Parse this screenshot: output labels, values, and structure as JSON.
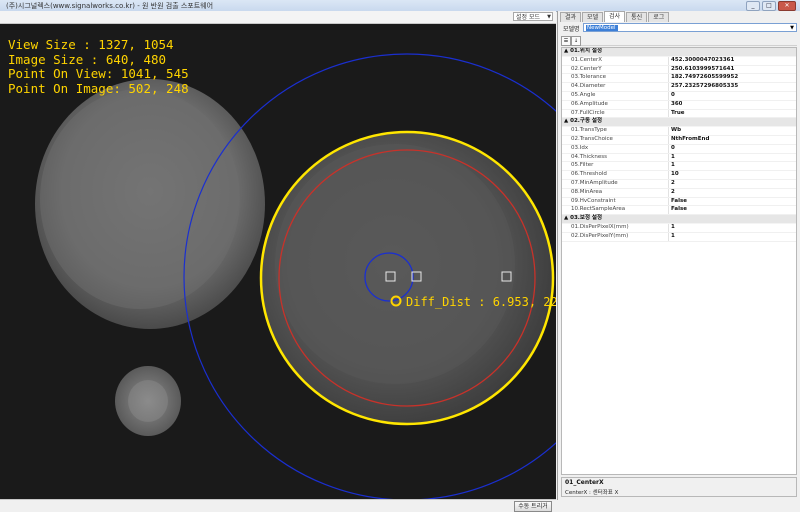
{
  "window": {
    "title": "(주)시그널렉스(www.signalworks.co.kr) - 원 반원 검출 스포트웨어",
    "minimize": "_",
    "maximize": "□",
    "close": "✕"
  },
  "toolbar": {
    "mode_label": "설정 모드"
  },
  "overlay": {
    "view_size": "View Size : 1327, 1054",
    "image_size": "Image Size : 640, 480",
    "point_on_view": "Point On View: 1041, 545",
    "point_on_image": "Point On Image: 502, 248",
    "diff_dist": "Diff_Dist : 6.953, 22."
  },
  "bottom": {
    "manual_trigger": "수동 트리거"
  },
  "panel": {
    "tabs": [
      {
        "label": "결과"
      },
      {
        "label": "모델"
      },
      {
        "label": "검사"
      },
      {
        "label": "통신"
      },
      {
        "label": "로그"
      }
    ],
    "model_label": "모델명",
    "model_value": "NewModel",
    "categories": [
      {
        "title": "01.위치 설정",
        "props": [
          {
            "name": "01.CenterX",
            "value": "452.3000047023361"
          },
          {
            "name": "02.CenterY",
            "value": "250.6103999571641"
          },
          {
            "name": "03.Tolerance",
            "value": "182.74972605599952"
          },
          {
            "name": "04.Diameter",
            "value": "257.23257296805335"
          },
          {
            "name": "05.Angle",
            "value": "0"
          },
          {
            "name": "06.Amplitude",
            "value": "360"
          },
          {
            "name": "07.FullCircle",
            "value": "True"
          }
        ]
      },
      {
        "title": "02.구동 설정",
        "props": [
          {
            "name": "01.TransType",
            "value": "Wb"
          },
          {
            "name": "02.TransChoice",
            "value": "NthFromEnd"
          },
          {
            "name": "03.Idx",
            "value": "0"
          },
          {
            "name": "04.Thickness",
            "value": "1"
          },
          {
            "name": "05.Filter",
            "value": "1"
          },
          {
            "name": "06.Threshold",
            "value": "10"
          },
          {
            "name": "07.MinAmplitude",
            "value": "2"
          },
          {
            "name": "08.MinArea",
            "value": "2"
          },
          {
            "name": "09.HvConstraint",
            "value": "False"
          },
          {
            "name": "10.RectSampleArea",
            "value": "False"
          }
        ]
      },
      {
        "title": "03.보정 설정",
        "props": [
          {
            "name": "01.DisPerPixelX(mm)",
            "value": "1"
          },
          {
            "name": "02.DisPerPixelY(mm)",
            "value": "1"
          }
        ]
      }
    ],
    "description": {
      "title": "01_CenterX",
      "text": "CenterX : 센터좌표 X"
    }
  },
  "colors": {
    "overlay_text": "#ffd400",
    "blue_circle": "#1a2fd0",
    "red_circle": "#c8322a",
    "yellow_circle": "#ffe600"
  },
  "icons": [
    "sort-categorized-icon",
    "sort-alphabetical-icon",
    "dropdown-arrow-icon"
  ]
}
